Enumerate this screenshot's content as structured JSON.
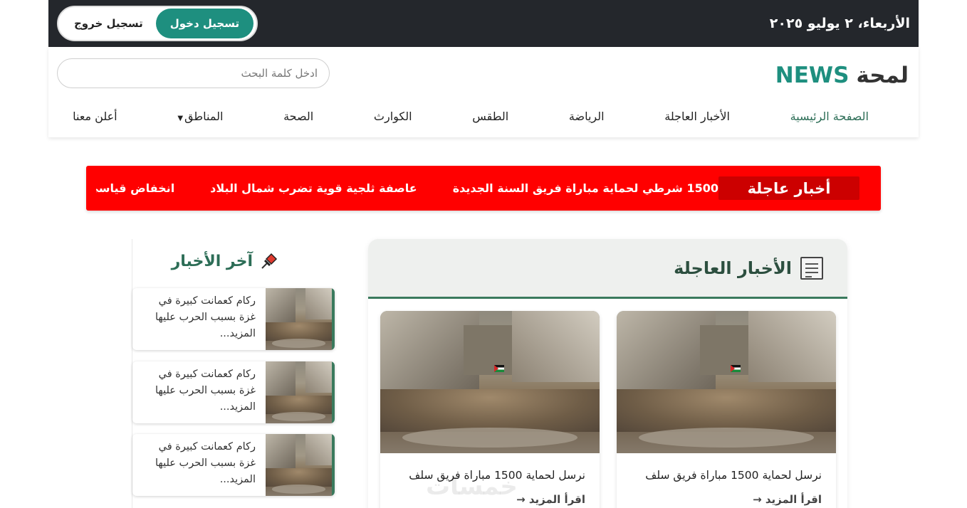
{
  "topbar": {
    "date": "الأربعاء، ٢ يوليو ٢٠٢٥",
    "login_label": "تسجيل دخول",
    "logout_label": "تسجيل خروج"
  },
  "header": {
    "logo_word": "لمحة",
    "logo_brand": "NEWS",
    "search_placeholder": "ادخل كلمة البحث"
  },
  "nav": {
    "items": [
      {
        "label": "الصفحة الرئيسية"
      },
      {
        "label": "الأخبار العاجلة"
      },
      {
        "label": "الرياضة"
      },
      {
        "label": "الطقس"
      },
      {
        "label": "الكوارث"
      },
      {
        "label": "الصحة"
      },
      {
        "label": "المناطق"
      },
      {
        "label": "أعلن معنا"
      }
    ]
  },
  "ticker": {
    "label": "أخبار عاجلة",
    "items": [
      "1500 شرطي لحماية مباراة فريق السنة الجديدة",
      "عاصفة ثلجية قوية تضرب شمال البلاد",
      "انخفاض قياسي في درجات"
    ]
  },
  "main": {
    "title": "الأخبار العاجلة",
    "cards": [
      {
        "title": "نرسل لحماية 1500 مباراة فريق سلف",
        "more": "اقرأ المزيد →"
      },
      {
        "title": "نرسل لحماية 1500 مباراة فريق سلف",
        "more": "اقرأ المزيد →"
      }
    ]
  },
  "sidebar": {
    "title": "آخر الأخبار",
    "items": [
      {
        "text": "ركام كعمانت كبيرة في غزة بسبب الحرب عليها المزيد..."
      },
      {
        "text": "ركام كعمانت كبيرة في غزة بسبب الحرب عليها المزيد..."
      },
      {
        "text": "ركام كعمانت كبيرة في غزة بسبب الحرب عليها المزيد..."
      }
    ]
  },
  "watermark": "خمسات",
  "colors": {
    "brand": "#1e8f7f",
    "topbar": "#24272c",
    "ticker": "#ff0000",
    "section_accent": "#3a7a5d"
  }
}
